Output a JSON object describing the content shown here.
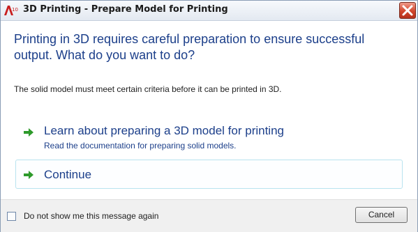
{
  "window": {
    "title": "3D Printing - Prepare Model for Printing",
    "app_icon": "autocad-a-icon",
    "close_icon": "close-icon"
  },
  "main_instruction": "Printing in 3D requires careful preparation to ensure successful output. What do you want to do?",
  "content": "The solid model must meet certain criteria before it can be printed in 3D.",
  "command_links": [
    {
      "icon": "green-arrow-icon",
      "title": "Learn about preparing a 3D model for printing",
      "description": "Read the documentation for preparing solid models."
    },
    {
      "icon": "green-arrow-icon",
      "title": "Continue"
    }
  ],
  "footer": {
    "checkbox_label": "Do not show me this message again",
    "checkbox_checked": false,
    "cancel_label": "Cancel"
  },
  "colors": {
    "instruction_blue": "#1c3f8a",
    "arrow_green": "#2e9a2b",
    "close_red": "#d1462c"
  }
}
